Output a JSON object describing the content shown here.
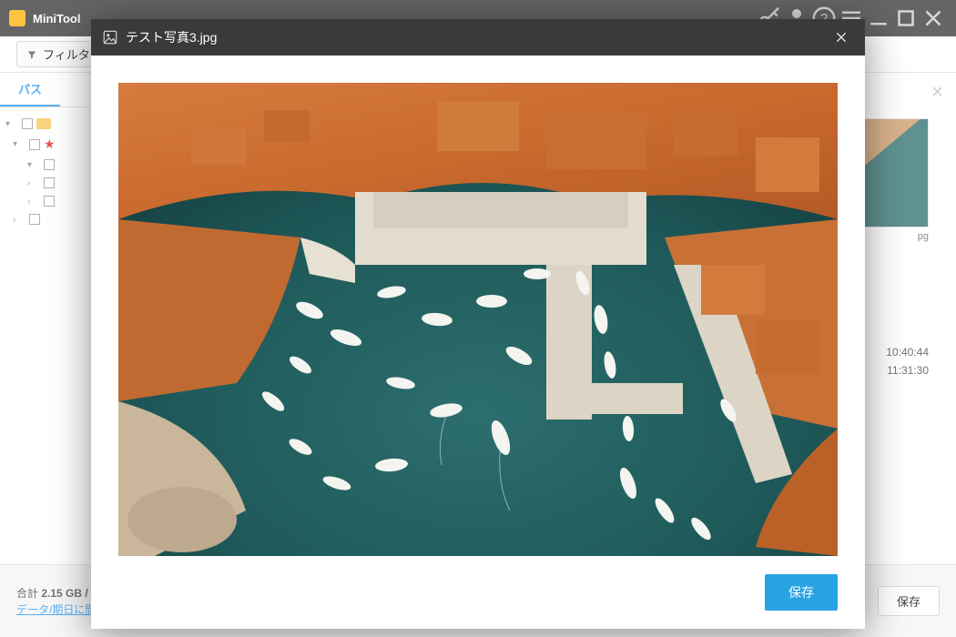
{
  "app": {
    "title": "MiniTool"
  },
  "toolbar": {
    "filter_label": "フィルタ"
  },
  "sidebar": {
    "tab_path_label": "パス",
    "nodes": [
      {
        "level": 0
      },
      {
        "level": 1
      },
      {
        "level": 2
      },
      {
        "level": 2
      },
      {
        "level": 2
      },
      {
        "level": 1
      }
    ]
  },
  "content": {
    "thumb_ext": "pg",
    "row1_time": "10:40:44",
    "row2_time": "11:31:30"
  },
  "footer": {
    "total_label": "合計",
    "total_value": "2.15 GB /",
    "link_text": "データ/期日に問題",
    "save_label": "保存"
  },
  "modal": {
    "filename": "テスト写真3.jpg",
    "save_label": "保存"
  }
}
